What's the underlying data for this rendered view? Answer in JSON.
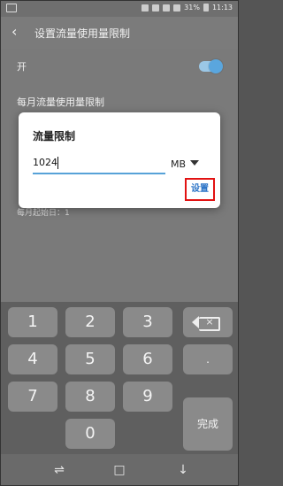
{
  "status_bar": {
    "battery_percent": "31%",
    "time": "11:13"
  },
  "app_bar": {
    "title": "设置流量使用量限制"
  },
  "rows": {
    "on_label": "开",
    "monthly_limit_label": "每月流量使用量限制",
    "start_day_label": "每月起始日：1"
  },
  "dialog": {
    "title": "流量限制",
    "input_value": "1024",
    "unit": "MB",
    "confirm_label": "设置"
  },
  "keyboard": {
    "keys": [
      "1",
      "2",
      "3",
      "4",
      "5",
      "6",
      "7",
      "8",
      "9",
      "0",
      "."
    ],
    "done_label": "完成"
  }
}
